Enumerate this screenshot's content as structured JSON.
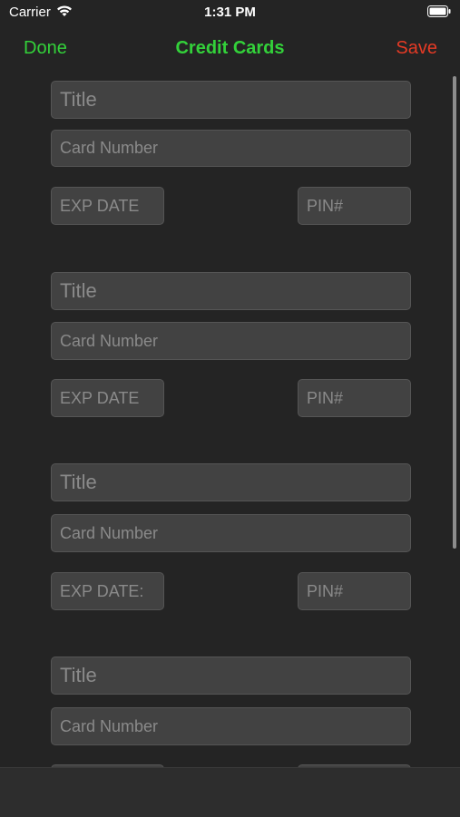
{
  "status": {
    "carrier": "Carrier",
    "time": "1:31 PM"
  },
  "nav": {
    "done": "Done",
    "title": "Credit Cards",
    "save": "Save"
  },
  "cards": [
    {
      "title": "Title",
      "card_number": "Card Number",
      "exp": "EXP DATE",
      "pin": "PIN#"
    },
    {
      "title": "Title",
      "card_number": "Card Number",
      "exp": "EXP DATE",
      "pin": "PIN#"
    },
    {
      "title": "Title",
      "card_number": "Card Number",
      "exp": "EXP DATE:",
      "pin": "PIN#"
    },
    {
      "title": "Title",
      "card_number": "Card Number",
      "exp": "",
      "pin": ""
    }
  ],
  "icons": {
    "wifi": "wifi-icon",
    "battery": "battery-icon"
  },
  "colors": {
    "accent_green": "#33d13a",
    "save_red": "#e53a25",
    "background": "#242424",
    "field": "#424242"
  }
}
